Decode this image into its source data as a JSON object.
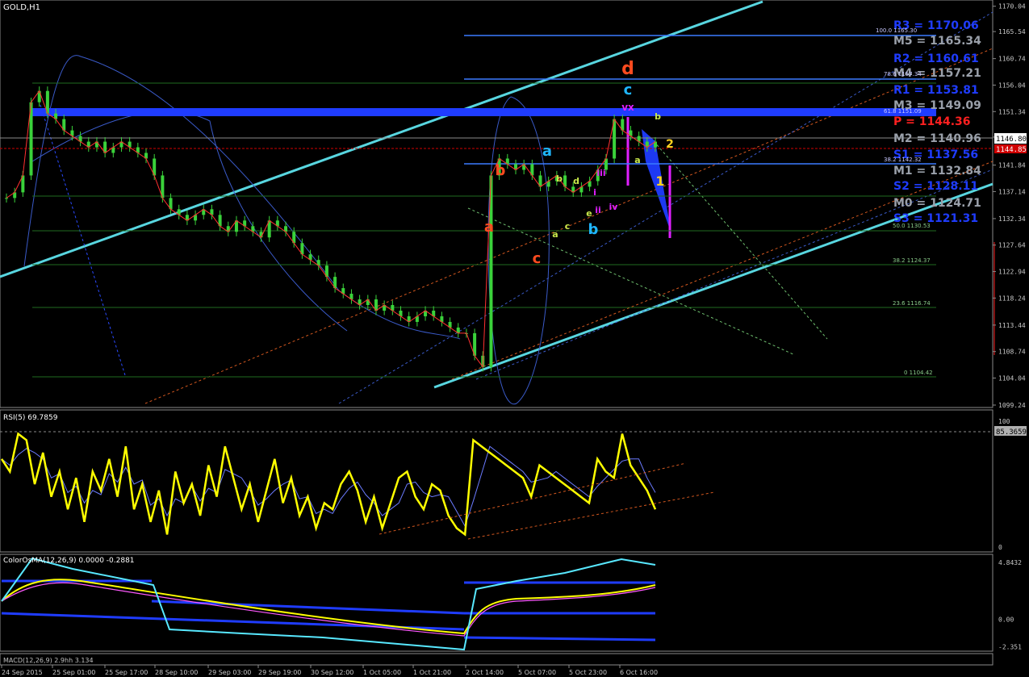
{
  "chart_data": {
    "type": "line",
    "title": "GOLD,H1",
    "symbol": "GOLD",
    "timeframe": "H1",
    "current_price": "1146.80",
    "alt_price": "1144.85",
    "ylim": [
      1099.24,
      1170.0
    ],
    "price_axis_ticks": [
      "1170.04",
      "1165.54",
      "1160.74",
      "1156.04",
      "1151.34",
      "1146.80",
      "1141.84",
      "1137.14",
      "1132.34",
      "1127.64",
      "1122.94",
      "1118.24",
      "1113.44",
      "1108.74",
      "1104.04",
      "1099.24"
    ],
    "time_axis_ticks": [
      "24 Sep 2015",
      "25 Sep 01:00",
      "25 Sep 17:00",
      "28 Sep 10:00",
      "29 Sep 03:00",
      "29 Sep 19:00",
      "30 Sep 12:00",
      "1 Oct 05:00",
      "1 Oct 21:00",
      "2 Oct 14:00",
      "5 Oct 07:00",
      "5 Oct 23:00",
      "6 Oct 16:00"
    ],
    "close_series": [
      1136,
      1137,
      1140,
      1153,
      1155,
      1151,
      1150,
      1148,
      1147,
      1146,
      1145,
      1146,
      1144,
      1145,
      1146,
      1145,
      1144,
      1143,
      1140,
      1136,
      1134,
      1133,
      1132,
      1133,
      1134,
      1133,
      1131,
      1130,
      1132,
      1131,
      1130,
      1129,
      1132,
      1131,
      1130,
      1128,
      1126,
      1125,
      1124,
      1122,
      1120,
      1119,
      1118,
      1117,
      1118,
      1116,
      1117,
      1116,
      1115,
      1114,
      1115,
      1116,
      1115,
      1114,
      1113,
      1112,
      1112,
      1108,
      1106,
      1140,
      1143,
      1142,
      1141,
      1142,
      1140,
      1138,
      1139,
      1140,
      1138,
      1137,
      1138,
      1139,
      1141,
      1143,
      1150,
      1148,
      1147,
      1146,
      1145,
      1146
    ],
    "pivots": [
      {
        "label": "R3 = 1170.06",
        "color": "#1f3cff"
      },
      {
        "label": "M5 = 1165.34",
        "color": "#9aa0aa"
      },
      {
        "label": "R2 = 1160.61",
        "color": "#1f3cff"
      },
      {
        "label": "M4 = 1157.21",
        "color": "#9aa0aa"
      },
      {
        "label": "R1 = 1153.81",
        "color": "#1f3cff"
      },
      {
        "label": "M3 = 1149.09",
        "color": "#9aa0aa"
      },
      {
        "label": "P = 1144.36",
        "color": "#ff2020"
      },
      {
        "label": "M2 = 1140.96",
        "color": "#9aa0aa"
      },
      {
        "label": "S1 = 1137.56",
        "color": "#1f3cff"
      },
      {
        "label": "M1 = 1132.84",
        "color": "#9aa0aa"
      },
      {
        "label": "S2 = 1128.11",
        "color": "#1f3cff"
      },
      {
        "label": "M0 = 1124.71",
        "color": "#9aa0aa"
      },
      {
        "label": "S3 = 1121.31",
        "color": "#1f3cff"
      }
    ],
    "fibo_levels": [
      {
        "label": "100.0  1165.30"
      },
      {
        "label": "78.6  1157.34"
      },
      {
        "label": "61.8  1151.09"
      },
      {
        "label": "38.2  1142.32"
      },
      {
        "label": "50.0  1130.53"
      },
      {
        "label": "38.2  1124.37"
      },
      {
        "label": "23.6  1116.74"
      },
      {
        "label": "0  1104.42"
      }
    ],
    "wave_labels": [
      {
        "text": "d",
        "color": "#ff4b1f"
      },
      {
        "text": "c",
        "color": "#1fb6ff"
      },
      {
        "text": "b",
        "color": "#ff4b1f"
      },
      {
        "text": "a",
        "color": "#1fb6ff"
      },
      {
        "text": "a",
        "color": "#ff4b1f"
      },
      {
        "text": "c",
        "color": "#ff4b1f"
      },
      {
        "text": "b",
        "color": "#1fb6ff"
      },
      {
        "text": "b",
        "color": "#c8e84a"
      },
      {
        "text": "d",
        "color": "#c8e84a"
      },
      {
        "text": "a",
        "color": "#c8e84a"
      },
      {
        "text": "c",
        "color": "#c8e84a"
      },
      {
        "text": "e",
        "color": "#c8e84a"
      },
      {
        "text": "iii",
        "color": "#e01fff"
      },
      {
        "text": "ii",
        "color": "#e01fff"
      },
      {
        "text": "iv",
        "color": "#e01fff"
      },
      {
        "text": "i",
        "color": "#e01fff"
      },
      {
        "text": "vx",
        "color": "#e01fff"
      },
      {
        "text": "b",
        "color": "#c8e84a"
      },
      {
        "text": "a",
        "color": "#c8e84a"
      },
      {
        "text": "2",
        "color": "#ffd21f"
      },
      {
        "text": "1",
        "color": "#ffd21f"
      }
    ],
    "rsi": {
      "title": "RSI(5) 69.7859",
      "value_box": "85.3659",
      "ylim": [
        0,
        100
      ],
      "ticks": [
        "100",
        "0"
      ],
      "values": [
        70,
        60,
        90,
        85,
        50,
        75,
        40,
        60,
        30,
        55,
        20,
        60,
        45,
        70,
        40,
        80,
        30,
        50,
        20,
        45,
        10,
        60,
        35,
        50,
        25,
        65,
        40,
        80,
        55,
        30,
        50,
        20,
        45,
        70,
        35,
        55,
        25,
        40,
        15,
        35,
        30,
        50,
        60,
        45,
        20,
        40,
        15,
        35,
        55,
        60,
        40,
        30,
        50,
        45,
        25,
        15,
        10,
        85,
        80,
        75,
        70,
        65,
        60,
        55,
        40,
        65,
        60,
        55,
        50,
        45,
        40,
        35,
        70,
        60,
        55,
        90,
        65,
        55,
        45,
        30
      ]
    },
    "macd": {
      "title": "ColorOsMA(12,26,9) 0.0000 -0.2881",
      "ticks": [
        "4.8432",
        "0.00",
        "-2.351"
      ],
      "ylim": [
        -2.6,
        5.2
      ]
    },
    "bottom_label": "MACD(12,26,9) 2.9hh 3.134"
  }
}
